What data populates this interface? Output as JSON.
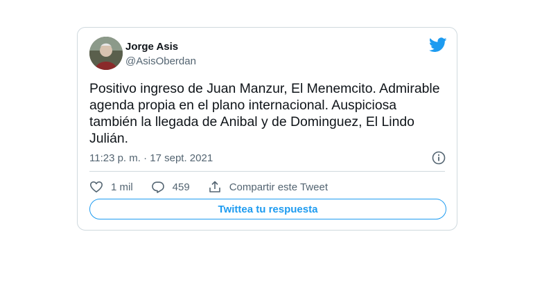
{
  "tweet": {
    "author": {
      "display_name": "Jorge Asis",
      "handle": "@AsisOberdan"
    },
    "text": "Positivo ingreso de Juan Manzur, El Menemcito. Admirable\nagenda propia en el plano internacional. Auspiciosa\ntambién la llegada de Anibal y de Dominguez, El Lindo\nJulián.",
    "timestamp": "11:23 p. m. · 17 sept. 2021",
    "actions": {
      "like_count": "1 mil",
      "reply_count": "459",
      "share_label": "Compartir este Tweet"
    },
    "reply_button_label": "Twittea tu respuesta"
  },
  "colors": {
    "brand": "#1d9bf0",
    "text": "#0f1419",
    "muted": "#536471",
    "border": "#cfd9de"
  },
  "icons": [
    "twitter-bird-icon",
    "info-icon",
    "heart-icon",
    "reply-bubble-icon",
    "share-icon"
  ]
}
